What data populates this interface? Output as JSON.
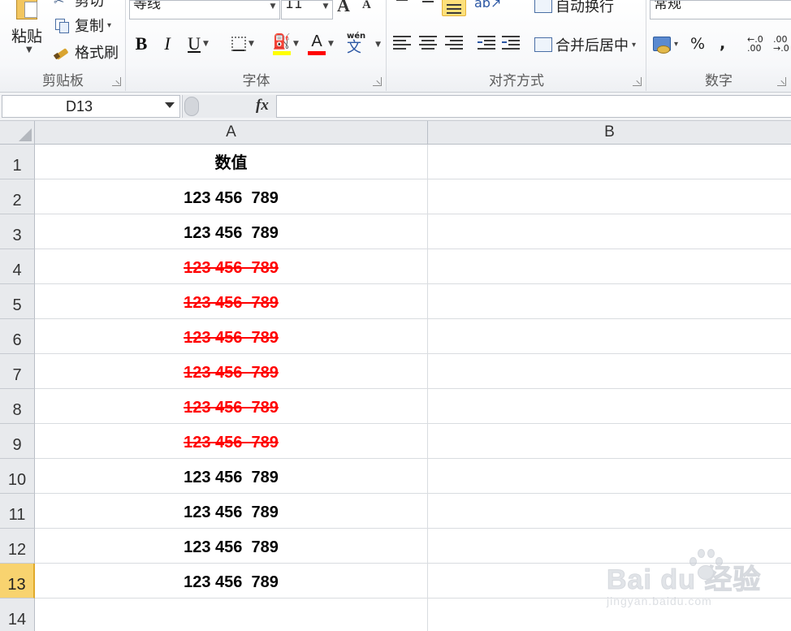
{
  "ribbon": {
    "clipboard": {
      "label": "剪贴板",
      "paste": "粘贴",
      "cut": "剪切",
      "copy": "复制",
      "format_painter": "格式刷"
    },
    "font": {
      "label": "字体",
      "font_name": "等线",
      "font_size": "11",
      "bold": "B",
      "italic": "I",
      "underline": "U",
      "grow": "A",
      "shrink": "A",
      "font_color_glyph": "A",
      "wen_glyph": "wén",
      "wen_char": "文",
      "fill_color": "#ffff00",
      "font_color": "#ff0000"
    },
    "alignment": {
      "label": "对齐方式",
      "wrap_text": "自动换行",
      "merge_center": "合并后居中"
    },
    "number": {
      "label": "数字",
      "format": "常规",
      "percent": "%",
      "comma": ",",
      "increase_decimal": "⁺.0 .00",
      "decrease_decimal": ".00 ⁻.0"
    }
  },
  "formula_bar": {
    "name_box": "D13",
    "fx": "fx",
    "formula": ""
  },
  "sheet": {
    "columns": [
      "A",
      "B"
    ],
    "rows": [
      {
        "num": "1",
        "a": "数值",
        "style": "header"
      },
      {
        "num": "2",
        "a": "123 456  789",
        "style": "normal"
      },
      {
        "num": "3",
        "a": "123 456  789",
        "style": "normal"
      },
      {
        "num": "4",
        "a": "123 456  789",
        "style": "strike"
      },
      {
        "num": "5",
        "a": "123 456  789",
        "style": "strike"
      },
      {
        "num": "6",
        "a": "123 456  789",
        "style": "strike"
      },
      {
        "num": "7",
        "a": "123 456  789",
        "style": "strike"
      },
      {
        "num": "8",
        "a": "123 456  789",
        "style": "strike"
      },
      {
        "num": "9",
        "a": "123 456  789",
        "style": "strike"
      },
      {
        "num": "10",
        "a": "123 456  789",
        "style": "normal"
      },
      {
        "num": "11",
        "a": "123 456  789",
        "style": "normal"
      },
      {
        "num": "12",
        "a": "123 456  789",
        "style": "normal"
      },
      {
        "num": "13",
        "a": "123 456  789",
        "style": "normal"
      },
      {
        "num": "14",
        "a": "",
        "style": "normal"
      }
    ],
    "selected_row": "13",
    "strike_color": "#ff0000",
    "selected_header_color": "#f8d36f"
  },
  "watermark": {
    "brand": "Bai du 经验",
    "url": "jingyan.baidu.com"
  }
}
